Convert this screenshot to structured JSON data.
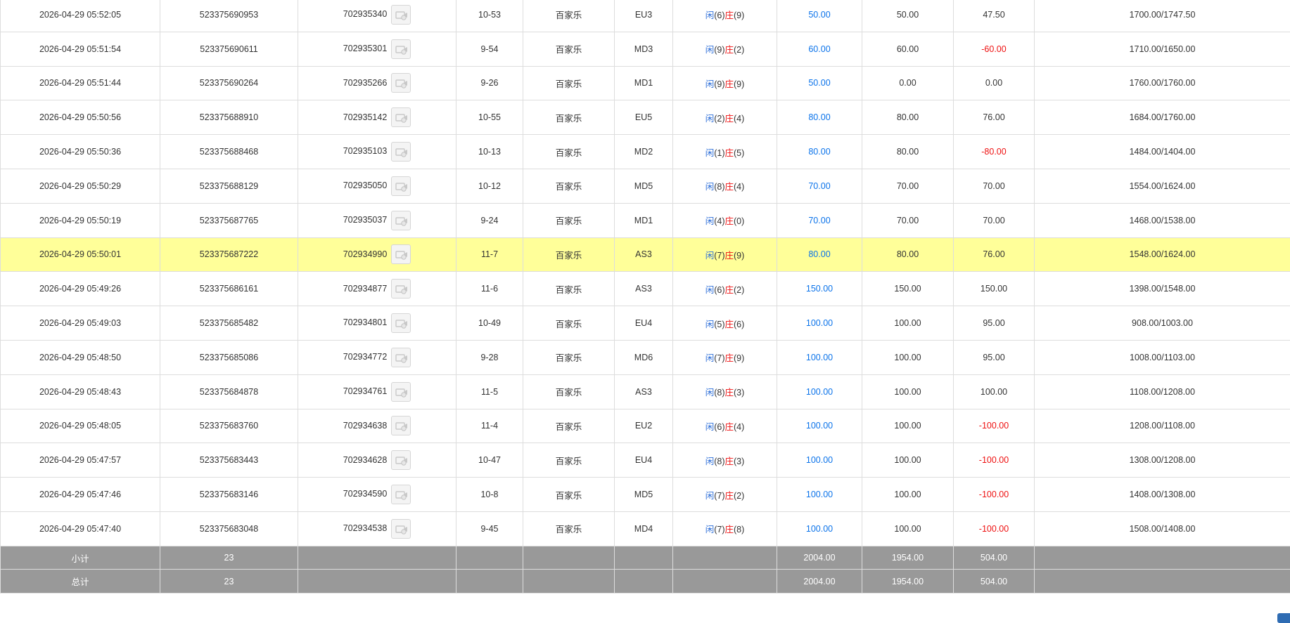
{
  "colors": {
    "header_bg": "#999999",
    "highlight": "#ffff99",
    "blue": "#0b73ea",
    "red": "#ee1111"
  },
  "icons": {
    "row_action": "video-replay-icon"
  },
  "rows": [
    {
      "time": "2026-04-29 05:52:05",
      "order_no": "523375690953",
      "game_no": "702935340",
      "shoe": "10-53",
      "game": "百家乐",
      "table": "EU3",
      "player_label": "闲",
      "player_num": "(6)",
      "banker_label": "庄",
      "banker_num": "(9)",
      "bet": "50.00",
      "valid": "50.00",
      "win": "47.50",
      "win_neg": false,
      "balance": "1700.00/1747.50",
      "highlight": false
    },
    {
      "time": "2026-04-29 05:51:54",
      "order_no": "523375690611",
      "game_no": "702935301",
      "shoe": "9-54",
      "game": "百家乐",
      "table": "MD3",
      "player_label": "闲",
      "player_num": "(9)",
      "banker_label": "庄",
      "banker_num": "(2)",
      "bet": "60.00",
      "valid": "60.00",
      "win": "-60.00",
      "win_neg": true,
      "balance": "1710.00/1650.00",
      "highlight": false
    },
    {
      "time": "2026-04-29 05:51:44",
      "order_no": "523375690264",
      "game_no": "702935266",
      "shoe": "9-26",
      "game": "百家乐",
      "table": "MD1",
      "player_label": "闲",
      "player_num": "(9)",
      "banker_label": "庄",
      "banker_num": "(9)",
      "bet": "50.00",
      "valid": "0.00",
      "win": "0.00",
      "win_neg": false,
      "balance": "1760.00/1760.00",
      "highlight": false
    },
    {
      "time": "2026-04-29 05:50:56",
      "order_no": "523375688910",
      "game_no": "702935142",
      "shoe": "10-55",
      "game": "百家乐",
      "table": "EU5",
      "player_label": "闲",
      "player_num": "(2)",
      "banker_label": "庄",
      "banker_num": "(4)",
      "bet": "80.00",
      "valid": "80.00",
      "win": "76.00",
      "win_neg": false,
      "balance": "1684.00/1760.00",
      "highlight": false
    },
    {
      "time": "2026-04-29 05:50:36",
      "order_no": "523375688468",
      "game_no": "702935103",
      "shoe": "10-13",
      "game": "百家乐",
      "table": "MD2",
      "player_label": "闲",
      "player_num": "(1)",
      "banker_label": "庄",
      "banker_num": "(5)",
      "bet": "80.00",
      "valid": "80.00",
      "win": "-80.00",
      "win_neg": true,
      "balance": "1484.00/1404.00",
      "highlight": false
    },
    {
      "time": "2026-04-29 05:50:29",
      "order_no": "523375688129",
      "game_no": "702935050",
      "shoe": "10-12",
      "game": "百家乐",
      "table": "MD5",
      "player_label": "闲",
      "player_num": "(8)",
      "banker_label": "庄",
      "banker_num": "(4)",
      "bet": "70.00",
      "valid": "70.00",
      "win": "70.00",
      "win_neg": false,
      "balance": "1554.00/1624.00",
      "highlight": false
    },
    {
      "time": "2026-04-29 05:50:19",
      "order_no": "523375687765",
      "game_no": "702935037",
      "shoe": "9-24",
      "game": "百家乐",
      "table": "MD1",
      "player_label": "闲",
      "player_num": "(4)",
      "banker_label": "庄",
      "banker_num": "(0)",
      "bet": "70.00",
      "valid": "70.00",
      "win": "70.00",
      "win_neg": false,
      "balance": "1468.00/1538.00",
      "highlight": false
    },
    {
      "time": "2026-04-29 05:50:01",
      "order_no": "523375687222",
      "game_no": "702934990",
      "shoe": "11-7",
      "game": "百家乐",
      "table": "AS3",
      "player_label": "闲",
      "player_num": "(7)",
      "banker_label": "庄",
      "banker_num": "(9)",
      "bet": "80.00",
      "valid": "80.00",
      "win": "76.00",
      "win_neg": false,
      "balance": "1548.00/1624.00",
      "highlight": true
    },
    {
      "time": "2026-04-29 05:49:26",
      "order_no": "523375686161",
      "game_no": "702934877",
      "shoe": "11-6",
      "game": "百家乐",
      "table": "AS3",
      "player_label": "闲",
      "player_num": "(6)",
      "banker_label": "庄",
      "banker_num": "(2)",
      "bet": "150.00",
      "valid": "150.00",
      "win": "150.00",
      "win_neg": false,
      "balance": "1398.00/1548.00",
      "highlight": false
    },
    {
      "time": "2026-04-29 05:49:03",
      "order_no": "523375685482",
      "game_no": "702934801",
      "shoe": "10-49",
      "game": "百家乐",
      "table": "EU4",
      "player_label": "闲",
      "player_num": "(5)",
      "banker_label": "庄",
      "banker_num": "(6)",
      "bet": "100.00",
      "valid": "100.00",
      "win": "95.00",
      "win_neg": false,
      "balance": "908.00/1003.00",
      "highlight": false
    },
    {
      "time": "2026-04-29 05:48:50",
      "order_no": "523375685086",
      "game_no": "702934772",
      "shoe": "9-28",
      "game": "百家乐",
      "table": "MD6",
      "player_label": "闲",
      "player_num": "(7)",
      "banker_label": "庄",
      "banker_num": "(9)",
      "bet": "100.00",
      "valid": "100.00",
      "win": "95.00",
      "win_neg": false,
      "balance": "1008.00/1103.00",
      "highlight": false
    },
    {
      "time": "2026-04-29 05:48:43",
      "order_no": "523375684878",
      "game_no": "702934761",
      "shoe": "11-5",
      "game": "百家乐",
      "table": "AS3",
      "player_label": "闲",
      "player_num": "(8)",
      "banker_label": "庄",
      "banker_num": "(3)",
      "bet": "100.00",
      "valid": "100.00",
      "win": "100.00",
      "win_neg": false,
      "balance": "1108.00/1208.00",
      "highlight": false
    },
    {
      "time": "2026-04-29 05:48:05",
      "order_no": "523375683760",
      "game_no": "702934638",
      "shoe": "11-4",
      "game": "百家乐",
      "table": "EU2",
      "player_label": "闲",
      "player_num": "(6)",
      "banker_label": "庄",
      "banker_num": "(4)",
      "bet": "100.00",
      "valid": "100.00",
      "win": "-100.00",
      "win_neg": true,
      "balance": "1208.00/1108.00",
      "highlight": false
    },
    {
      "time": "2026-04-29 05:47:57",
      "order_no": "523375683443",
      "game_no": "702934628",
      "shoe": "10-47",
      "game": "百家乐",
      "table": "EU4",
      "player_label": "闲",
      "player_num": "(8)",
      "banker_label": "庄",
      "banker_num": "(3)",
      "bet": "100.00",
      "valid": "100.00",
      "win": "-100.00",
      "win_neg": true,
      "balance": "1308.00/1208.00",
      "highlight": false
    },
    {
      "time": "2026-04-29 05:47:46",
      "order_no": "523375683146",
      "game_no": "702934590",
      "shoe": "10-8",
      "game": "百家乐",
      "table": "MD5",
      "player_label": "闲",
      "player_num": "(7)",
      "banker_label": "庄",
      "banker_num": "(2)",
      "bet": "100.00",
      "valid": "100.00",
      "win": "-100.00",
      "win_neg": true,
      "balance": "1408.00/1308.00",
      "highlight": false
    },
    {
      "time": "2026-04-29 05:47:40",
      "order_no": "523375683048",
      "game_no": "702934538",
      "shoe": "9-45",
      "game": "百家乐",
      "table": "MD4",
      "player_label": "闲",
      "player_num": "(7)",
      "banker_label": "庄",
      "banker_num": "(8)",
      "bet": "100.00",
      "valid": "100.00",
      "win": "-100.00",
      "win_neg": true,
      "balance": "1508.00/1408.00",
      "highlight": false
    }
  ],
  "totals": [
    {
      "label": "小计",
      "count": "23",
      "bet": "2004.00",
      "valid": "1954.00",
      "win": "504.00"
    },
    {
      "label": "总计",
      "count": "23",
      "bet": "2004.00",
      "valid": "1954.00",
      "win": "504.00"
    }
  ]
}
